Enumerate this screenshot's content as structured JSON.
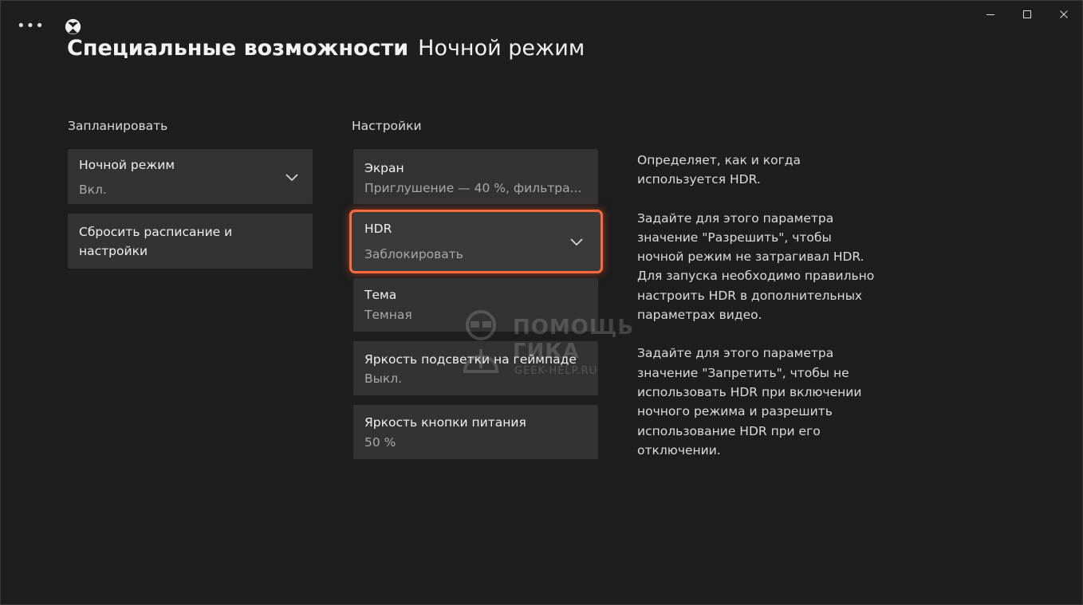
{
  "window": {
    "menu_glyph": "•••",
    "minimize_icon": "minimize-icon",
    "maximize_icon": "maximize-icon",
    "close_icon": "close-icon"
  },
  "header": {
    "title_main": "Специальные возможности",
    "title_sub": "Ночной режим"
  },
  "schedule": {
    "label": "Запланировать",
    "night_mode": {
      "title": "Ночной режим",
      "value": "Вкл."
    },
    "reset": {
      "title_line1": "Сбросить расписание и",
      "title_line2": "настройки"
    }
  },
  "settings": {
    "label": "Настройки",
    "items": [
      {
        "title": "Экран",
        "value": "Приглушение — 40 %, фильтра..."
      },
      {
        "title": "HDR",
        "value": "Заблокировать"
      },
      {
        "title": "Тема",
        "value": "Темная"
      },
      {
        "title": "Яркость подсветки на геймпаде",
        "value": "Выкл."
      },
      {
        "title": "Яркость кнопки питания",
        "value": "50 %"
      }
    ]
  },
  "description": {
    "p1_l1": "Определяет, как и когда",
    "p1_l2": "используется HDR.",
    "p2_l1": "Задайте для этого параметра",
    "p2_l2": "значение \"Разрешить\", чтобы",
    "p2_l3": "ночной режим не затрагивал HDR.",
    "p2_l4": "Для запуска необходимо правильно",
    "p2_l5": "настроить HDR в дополнительных",
    "p2_l6": "параметрах видео.",
    "p3_l1": "Задайте для этого параметра",
    "p3_l2": "значение \"Запретить\", чтобы не",
    "p3_l3": "использовать HDR при включении",
    "p3_l4": "ночного режима и разрешить",
    "p3_l5": "использование HDR при его",
    "p3_l6": "отключении."
  },
  "watermark": {
    "line1": "ПОМОЩЬ",
    "line2": "ГИКА",
    "line3": "GEEK-HELP.RU"
  },
  "colors": {
    "background": "#1e1e1e",
    "tile": "#333333",
    "focus": "#ff6a3d"
  }
}
